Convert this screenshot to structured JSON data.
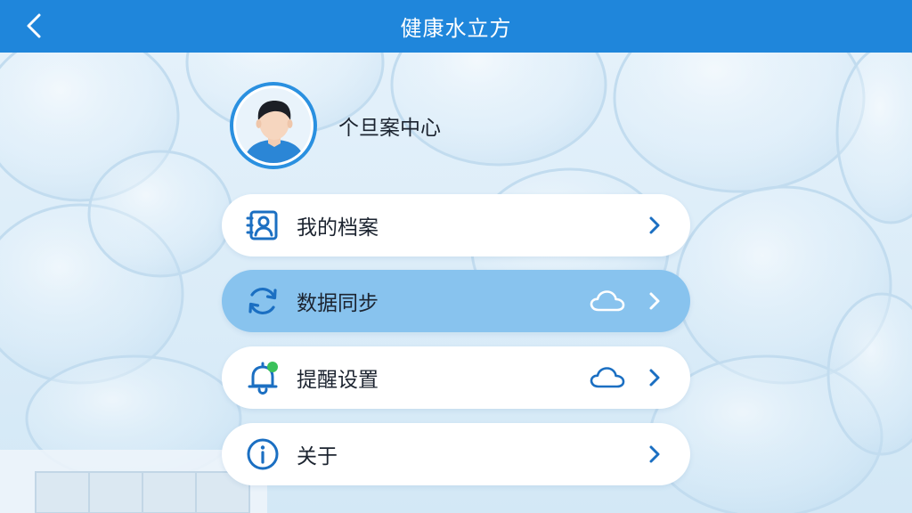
{
  "header": {
    "title": "健康水立方",
    "back_icon": "chevron-left-icon"
  },
  "profile": {
    "name": "个旦案中心",
    "avatar_icon": "user-avatar"
  },
  "menu": [
    {
      "label": "我的档案",
      "icon": "profile-card-icon",
      "cloud": false,
      "active": false
    },
    {
      "label": "数据同步",
      "icon": "sync-icon",
      "cloud": true,
      "active": true
    },
    {
      "label": "提醒设置",
      "icon": "bell-icon",
      "cloud": true,
      "active": false
    },
    {
      "label": "关于",
      "icon": "info-icon",
      "cloud": false,
      "active": false
    }
  ],
  "colors": {
    "primary": "#1f86db",
    "icon": "#1b6fc2",
    "active_row": "#88c3ee",
    "notify_dot": "#3ac15a"
  }
}
